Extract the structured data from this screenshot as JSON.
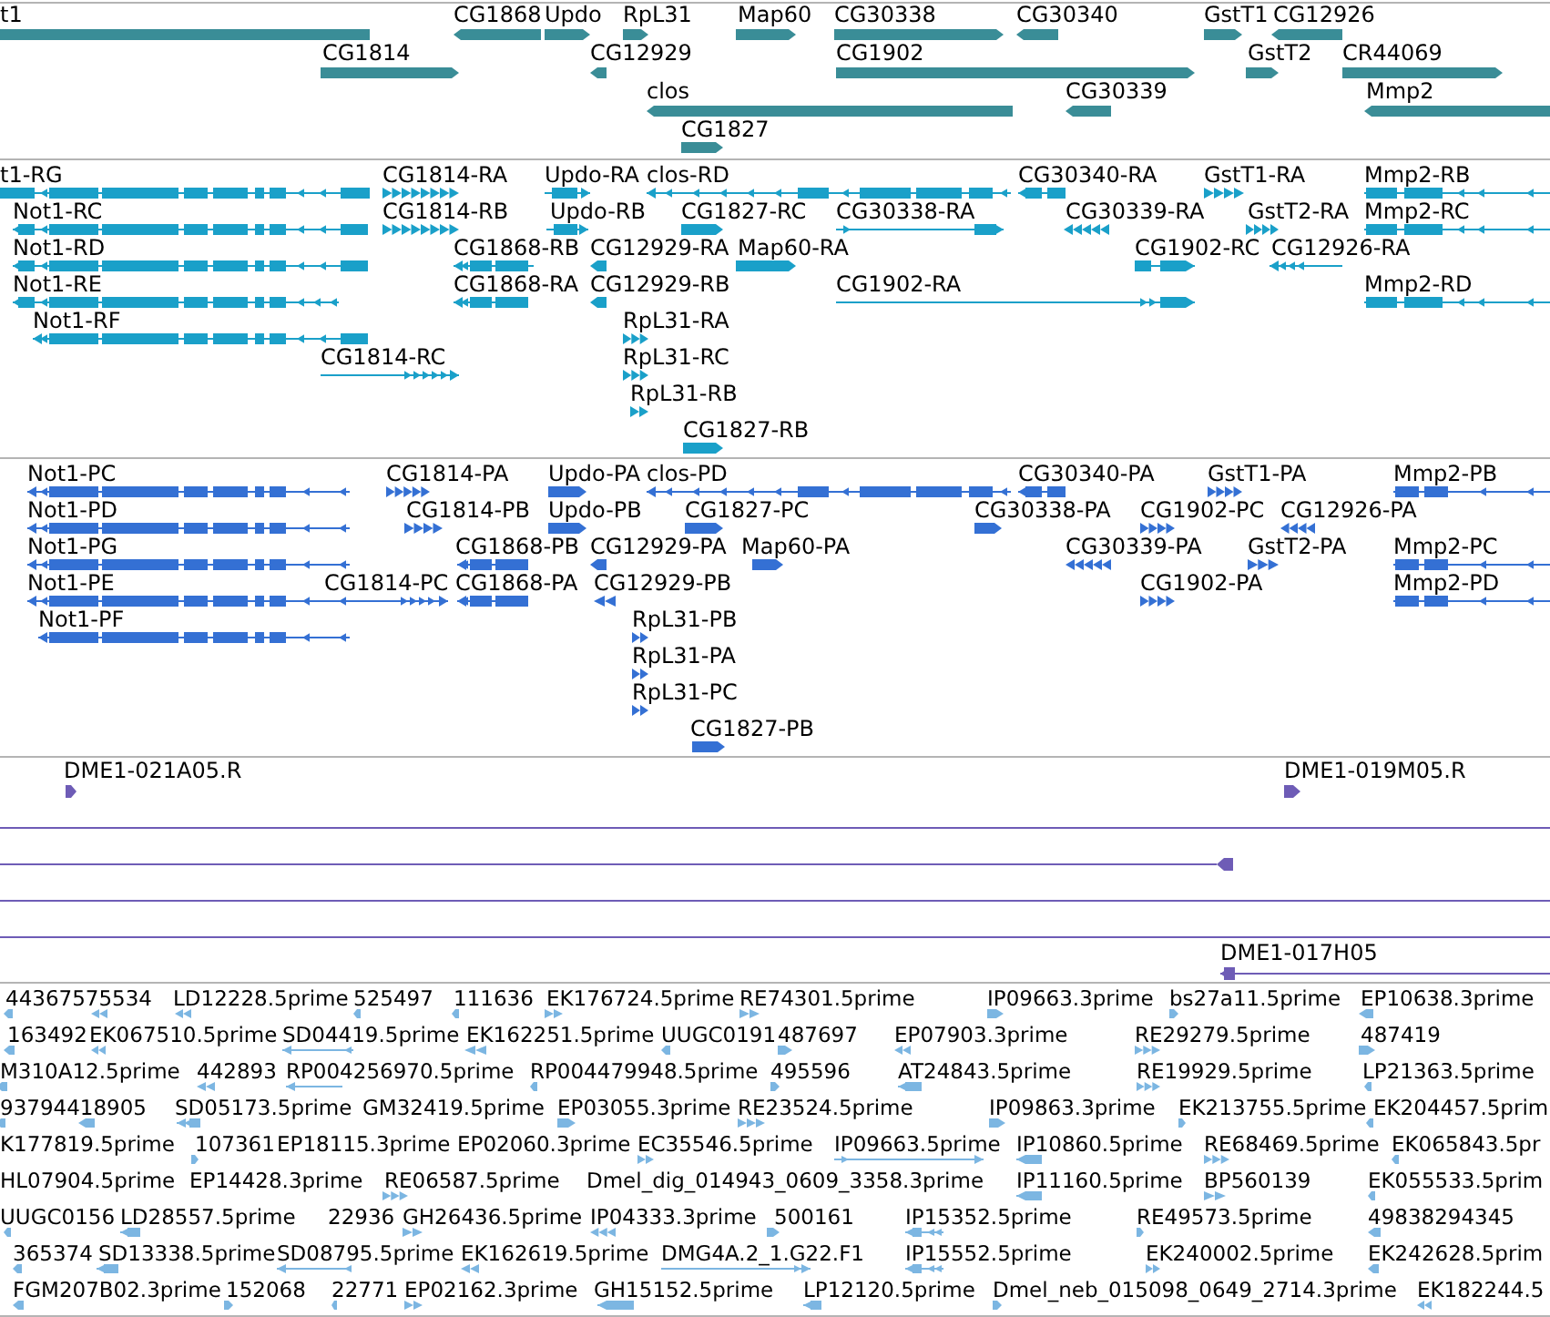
{
  "tracks": [
    {
      "kind": "gene",
      "features": [
        {
          "label": "t1",
          "reverse": true
        },
        {
          "label": "CG1868",
          "reverse": true
        },
        {
          "label": "Updo",
          "reverse": false
        },
        {
          "label": "RpL31",
          "reverse": false
        },
        {
          "label": "Map60",
          "reverse": false
        },
        {
          "label": "CG30338",
          "reverse": false
        },
        {
          "label": "CG30340",
          "reverse": true
        },
        {
          "label": "GstT1",
          "reverse": false
        },
        {
          "label": "CG12926",
          "reverse": true
        },
        {
          "label": "CG1814",
          "reverse": false
        },
        {
          "label": "CG12929",
          "reverse": true
        },
        {
          "label": "CG1902",
          "reverse": false
        },
        {
          "label": "GstT2",
          "reverse": false
        },
        {
          "label": "CR44069",
          "reverse": false
        },
        {
          "label": "clos",
          "reverse": true
        },
        {
          "label": "CG30339",
          "reverse": true
        },
        {
          "label": "Mmp2",
          "reverse": true
        },
        {
          "label": "CG1827",
          "reverse": false
        }
      ]
    },
    {
      "kind": "transcript",
      "features": [
        {
          "label": "t1-RG",
          "reverse": true
        },
        {
          "label": "CG1814-RA",
          "reverse": false
        },
        {
          "label": "Updo-RA",
          "reverse": false
        },
        {
          "label": "clos-RD",
          "reverse": true
        },
        {
          "label": "CG30340-RA",
          "reverse": true
        },
        {
          "label": "GstT1-RA",
          "reverse": false
        },
        {
          "label": "Mmp2-RB",
          "reverse": true
        },
        {
          "label": "Not1-RC",
          "reverse": true
        },
        {
          "label": "CG1814-RB",
          "reverse": false
        },
        {
          "label": "Updo-RB",
          "reverse": false
        },
        {
          "label": "CG1827-RC",
          "reverse": false
        },
        {
          "label": "CG30338-RA",
          "reverse": false
        },
        {
          "label": "CG30339-RA",
          "reverse": true
        },
        {
          "label": "GstT2-RA",
          "reverse": false
        },
        {
          "label": "Mmp2-RC",
          "reverse": true
        },
        {
          "label": "Not1-RD",
          "reverse": true
        },
        {
          "label": "CG1868-RB",
          "reverse": true
        },
        {
          "label": "CG12929-RA",
          "reverse": true
        },
        {
          "label": "Map60-RA",
          "reverse": false
        },
        {
          "label": "CG1902-RC",
          "reverse": false
        },
        {
          "label": "CG12926-RA",
          "reverse": true
        },
        {
          "label": "Not1-RE",
          "reverse": true
        },
        {
          "label": "CG1868-RA",
          "reverse": true
        },
        {
          "label": "CG12929-RB",
          "reverse": true
        },
        {
          "label": "CG1902-RA",
          "reverse": false
        },
        {
          "label": "Mmp2-RD",
          "reverse": true
        },
        {
          "label": "Not1-RF",
          "reverse": true
        },
        {
          "label": "RpL31-RA",
          "reverse": false
        },
        {
          "label": "CG1814-RC",
          "reverse": false
        },
        {
          "label": "RpL31-RC",
          "reverse": false
        },
        {
          "label": "RpL31-RB",
          "reverse": false
        },
        {
          "label": "CG1827-RB",
          "reverse": false
        }
      ]
    },
    {
      "kind": "protein",
      "features": [
        {
          "label": "Not1-PC",
          "reverse": true
        },
        {
          "label": "CG1814-PA",
          "reverse": false
        },
        {
          "label": "Updo-PA",
          "reverse": false
        },
        {
          "label": "clos-PD",
          "reverse": true
        },
        {
          "label": "CG30340-PA",
          "reverse": true
        },
        {
          "label": "GstT1-PA",
          "reverse": false
        },
        {
          "label": "Mmp2-PB",
          "reverse": true
        },
        {
          "label": "Not1-PD",
          "reverse": true
        },
        {
          "label": "CG1814-PB",
          "reverse": false
        },
        {
          "label": "Updo-PB",
          "reverse": false
        },
        {
          "label": "CG1827-PC",
          "reverse": false
        },
        {
          "label": "CG30338-PA",
          "reverse": false
        },
        {
          "label": "CG1902-PC",
          "reverse": false
        },
        {
          "label": "CG12926-PA",
          "reverse": true
        },
        {
          "label": "Not1-PG",
          "reverse": true
        },
        {
          "label": "CG1868-PB",
          "reverse": true
        },
        {
          "label": "CG12929-PA",
          "reverse": true
        },
        {
          "label": "Map60-PA",
          "reverse": false
        },
        {
          "label": "CG30339-PA",
          "reverse": true
        },
        {
          "label": "GstT2-PA",
          "reverse": false
        },
        {
          "label": "Mmp2-PC",
          "reverse": true
        },
        {
          "label": "Not1-PE",
          "reverse": true
        },
        {
          "label": "CG1814-PC",
          "reverse": false
        },
        {
          "label": "CG1868-PA",
          "reverse": true
        },
        {
          "label": "CG12929-PB",
          "reverse": true
        },
        {
          "label": "CG1902-PA",
          "reverse": false
        },
        {
          "label": "Mmp2-PD",
          "reverse": true
        },
        {
          "label": "Not1-PF",
          "reverse": true
        },
        {
          "label": "RpL31-PB",
          "reverse": false
        },
        {
          "label": "RpL31-PA",
          "reverse": false
        },
        {
          "label": "RpL31-PC",
          "reverse": false
        },
        {
          "label": "CG1827-PB",
          "reverse": false
        }
      ]
    },
    {
      "kind": "clone",
      "features": [
        {
          "kind": "marker",
          "label": "DME1-021A05.R",
          "reverse": false
        },
        {
          "kind": "marker",
          "label": "DME1-019M05.R",
          "reverse": false
        },
        {
          "kind": "line"
        },
        {
          "kind": "line-end",
          "reverse": true
        },
        {
          "kind": "line"
        },
        {
          "kind": "line"
        },
        {
          "kind": "marker",
          "label": "DME1-017H05",
          "reverse": true
        }
      ]
    },
    {
      "kind": "est",
      "features": [
        {
          "label": "44367575534",
          "reverse": true
        },
        {
          "reverse": true
        },
        {
          "label": "LD12228.5prime",
          "reverse": true
        },
        {
          "label": "525497",
          "reverse": true
        },
        {
          "label": "111636",
          "reverse": true
        },
        {
          "label": "EK176724.5prime",
          "reverse": false
        },
        {
          "label": "RE74301.5prime",
          "reverse": false
        },
        {
          "label": "IP09663.3prime",
          "reverse": false
        },
        {
          "label": "bs27a11.5prime",
          "reverse": false
        },
        {
          "label": "EP10638.3prime",
          "reverse": true
        },
        {
          "label": "163492",
          "reverse": true
        },
        {
          "label": "EK067510.5prime",
          "reverse": true
        },
        {
          "label": "SD04419.5prime",
          "reverse": true
        },
        {
          "label": "EK162251.5prime",
          "reverse": true
        },
        {
          "label": "UUGC0191",
          "reverse": true
        },
        {
          "label": "487697",
          "reverse": false
        },
        {
          "label": "EP07903.3prime",
          "reverse": true
        },
        {
          "label": "RE29279.5prime",
          "reverse": false
        },
        {
          "label": "487419",
          "reverse": false
        },
        {
          "label": "M310A12.5prime",
          "reverse": true
        },
        {
          "label": "442893",
          "reverse": true
        },
        {
          "label": "RP004256970.5prime",
          "reverse": true
        },
        {
          "label": "RP004479948.5prime",
          "reverse": true
        },
        {
          "label": "495596",
          "reverse": false
        },
        {
          "label": "AT24843.5prime",
          "reverse": true
        },
        {
          "label": "RE19929.5prime",
          "reverse": false
        },
        {
          "label": "LP21363.5prime",
          "reverse": true
        },
        {
          "label": "93794418905",
          "reverse": true
        },
        {
          "reverse": true
        },
        {
          "label": "SD05173.5prime",
          "reverse": true
        },
        {
          "label": "GM32419.5prime"
        },
        {
          "label": "EP03055.3prime",
          "reverse": false
        },
        {
          "label": "RE23524.5prime",
          "reverse": false
        },
        {
          "label": "IP09863.3prime",
          "reverse": false
        },
        {
          "label": "EK213755.5prime",
          "reverse": false
        },
        {
          "label": "EK204457.5prim",
          "reverse": true
        },
        {
          "label": "K177819.5prime"
        },
        {
          "label": "107361",
          "reverse": false
        },
        {
          "label": "EP18115.3prime"
        },
        {
          "label": "EP02060.3prime"
        },
        {
          "label": "EC35546.5prime",
          "reverse": false
        },
        {
          "label": "IP09663.5prime",
          "reverse": false
        },
        {
          "label": "IP10860.5prime",
          "reverse": true
        },
        {
          "label": "RE68469.5prime",
          "reverse": false
        },
        {
          "label": "EK065843.5pr",
          "reverse": true
        },
        {
          "label": "HL07904.5prime"
        },
        {
          "label": "EP14428.3prime"
        },
        {
          "label": "RE06587.5prime",
          "reverse": false
        },
        {
          "label": "Dmel_dig_014943_0609_3358.3prime"
        },
        {
          "label": "IP11160.5prime",
          "reverse": true
        },
        {
          "label": "BP560139",
          "reverse": false
        },
        {
          "label": "EK055533.5prim",
          "reverse": true
        },
        {
          "label": "UUGC0156",
          "reverse": true
        },
        {
          "label": "LD28557.5prime",
          "reverse": true
        },
        {
          "label": "22936"
        },
        {
          "label": "GH26436.5prime",
          "reverse": false
        },
        {
          "label": "IP04333.3prime",
          "reverse": true
        },
        {
          "label": "500161",
          "reverse": false
        },
        {
          "label": "IP15352.5prime",
          "reverse": true
        },
        {
          "label": "RE49573.5prime",
          "reverse": false
        },
        {
          "label": "49838294345",
          "reverse": true
        },
        {
          "label": "365374",
          "reverse": true
        },
        {
          "label": "SD13338.5prime",
          "reverse": true
        },
        {
          "label": "SD08795.5prime",
          "reverse": true
        },
        {
          "label": "EK162619.5prime",
          "reverse": true
        },
        {
          "label": "DMG4A.2_1.G22.F1",
          "reverse": false
        },
        {
          "label": "IP15552.5prime",
          "reverse": true
        },
        {
          "label": "EK240002.5prime",
          "reverse": false
        },
        {
          "label": "EK242628.5prim",
          "reverse": true
        },
        {
          "label": "FGM207B02.3prime",
          "reverse": true
        },
        {
          "label": "152068",
          "reverse": false
        },
        {
          "label": "22771",
          "reverse": true
        },
        {
          "label": "EP02162.3prime",
          "reverse": false
        },
        {
          "label": "GH15152.5prime",
          "reverse": true
        },
        {
          "label": "LP12120.5prime",
          "reverse": true
        },
        {
          "label": "Dmel_neb_015098_0649_2714.3prime",
          "reverse": false
        },
        {
          "label": "EK182244.5",
          "reverse": true
        }
      ]
    }
  ]
}
